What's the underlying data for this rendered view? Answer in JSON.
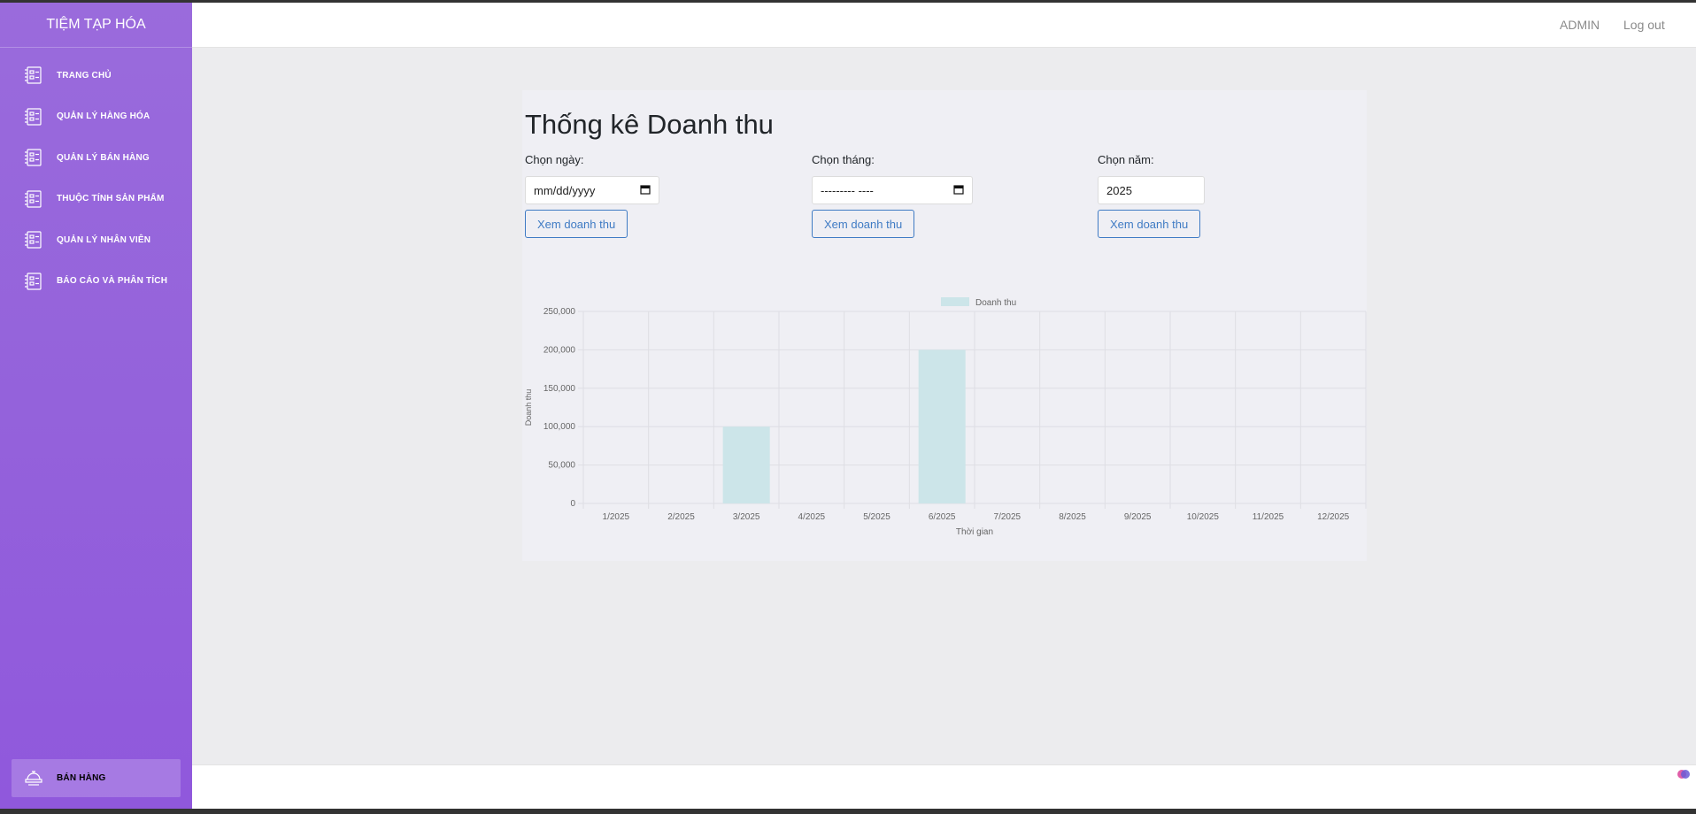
{
  "sidebar": {
    "brand": "TIỆM TẠP HÓA",
    "items": [
      {
        "label": "TRANG CHỦ"
      },
      {
        "label": "QUẢN LÝ HÀNG HÓA"
      },
      {
        "label": "QUẢN LÝ BÁN HÀNG"
      },
      {
        "label": "THUỘC TÍNH SẢN PHẨM"
      },
      {
        "label": "QUẢN LÝ NHÂN VIÊN"
      },
      {
        "label": "BÁO CÁO VÀ PHÂN TÍCH"
      }
    ],
    "sell_button": "BÁN HÀNG",
    "icon": "document-list-icon",
    "sell_icon": "cashier-icon"
  },
  "topbar": {
    "user": "ADMIN",
    "logout": "Log out"
  },
  "page": {
    "title": "Thống kê Doanh thu",
    "filters": {
      "day": {
        "label": "Chọn ngày:",
        "value": "mm/dd/yyyy",
        "button": "Xem doanh thu"
      },
      "month": {
        "label": "Chọn tháng:",
        "value": "--------- ----",
        "button": "Xem doanh thu"
      },
      "year": {
        "label": "Chọn năm:",
        "value": "2025",
        "button": "Xem doanh thu"
      }
    }
  },
  "colors": {
    "sidebar_top": "#9a6bdc",
    "sidebar_bottom": "#9058dc",
    "accent_blue": "#3f7bc4",
    "bar_fill": "#cce5e9"
  },
  "chart_data": {
    "type": "bar",
    "categories": [
      "1/2025",
      "2/2025",
      "3/2025",
      "4/2025",
      "5/2025",
      "6/2025",
      "7/2025",
      "8/2025",
      "9/2025",
      "10/2025",
      "11/2025",
      "12/2025"
    ],
    "series": [
      {
        "name": "Doanh thu",
        "values": [
          0,
          0,
          100000,
          0,
          0,
          200000,
          0,
          0,
          0,
          0,
          0,
          0
        ]
      }
    ],
    "xlabel": "Thời gian",
    "ylabel": "Doanh thu",
    "ylim": [
      0,
      250000
    ],
    "yticks": [
      "0",
      "50,000",
      "100,000",
      "150,000",
      "200,000",
      "250,000"
    ],
    "grid": true,
    "legend": "top-center"
  }
}
